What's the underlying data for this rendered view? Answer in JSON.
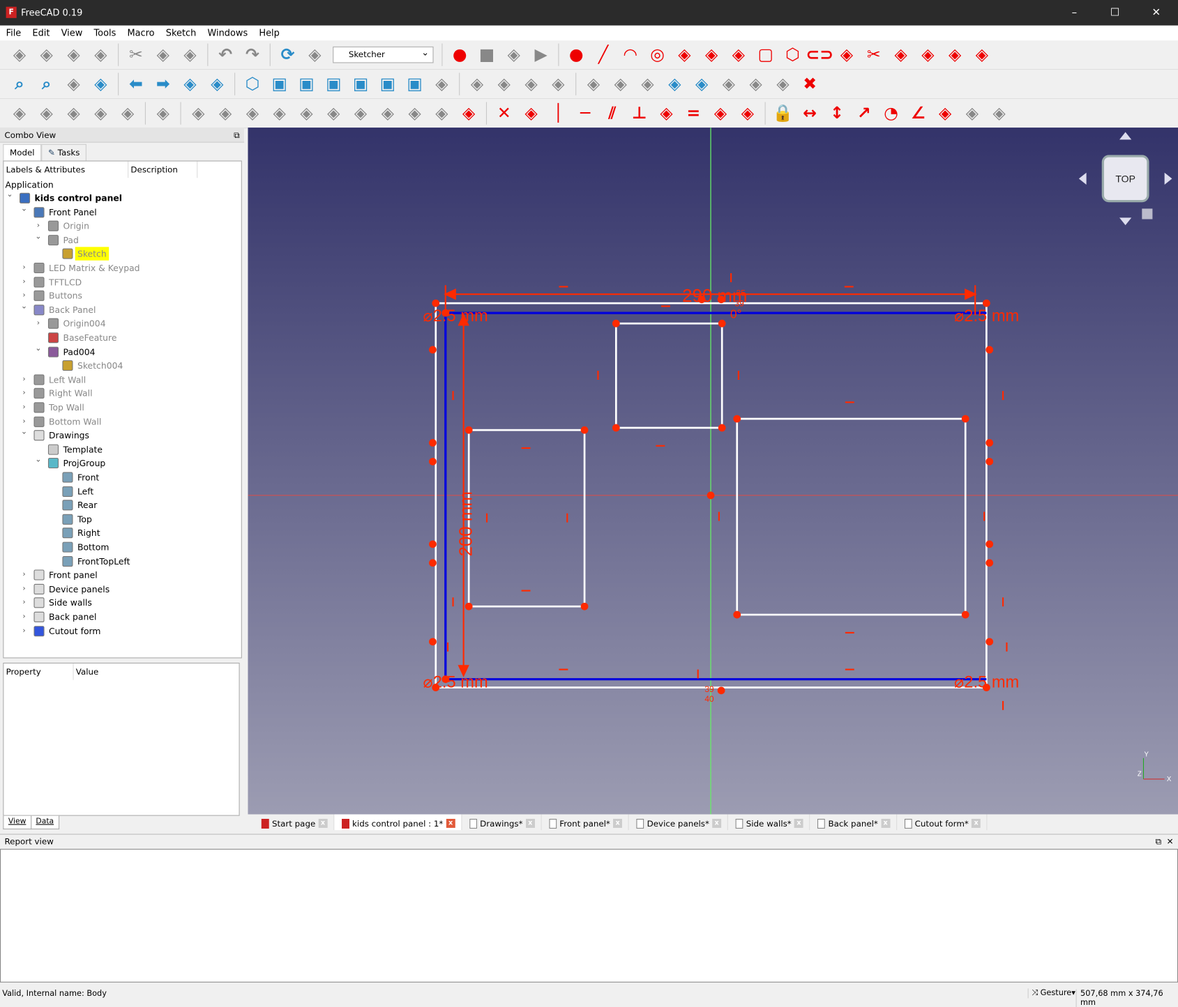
{
  "window": {
    "title": "FreeCAD 0.19",
    "minimize": "–",
    "maximize": "☐",
    "close": "✕"
  },
  "menu": [
    "File",
    "Edit",
    "View",
    "Tools",
    "Macro",
    "Sketch",
    "Windows",
    "Help"
  ],
  "toolbar1": [
    "new-file",
    "open-file",
    "save-file",
    "save-as",
    "sep",
    "cut",
    "copy",
    "paste",
    "sep",
    "undo",
    "redo",
    "sep",
    "refresh",
    "whats-this",
    "workbench",
    "sep",
    "record-macro",
    "stop-macro",
    "edit-macro",
    "run-macro",
    "sep",
    "sketch-point",
    "sketch-line",
    "sketch-arc",
    "sketch-circle",
    "sketch-conic",
    "sketch-bspline",
    "sketch-polyline",
    "sketch-rectangle",
    "sketch-polygon",
    "sketch-slot",
    "sketch-fillet",
    "sketch-trim",
    "sketch-extend",
    "sketch-external",
    "sketch-carbon-copy",
    "sketch-construction"
  ],
  "toolbar2": [
    "fit-all",
    "fit-selection",
    "draw-style",
    "bounding-box",
    "sep",
    "back",
    "forward",
    "sync-view",
    "std-views",
    "sep",
    "isometric",
    "front-view",
    "top-view",
    "right-view",
    "rear-view",
    "bottom-view",
    "left-view",
    "measure",
    "sep",
    "create-part",
    "create-group",
    "link",
    "link-actions",
    "sep",
    "new-sketch",
    "map-sketch",
    "leave-sketch",
    "view-sketch",
    "view-section",
    "merge-sketches",
    "mirror-sketch",
    "validate-sketch",
    "close-sketch"
  ],
  "toolbar3": [
    "show-hide-geometry",
    "select-elements",
    "select-constraints",
    "select-origin",
    "select-conflicting",
    "sep",
    "show-hide-grid",
    "sep",
    "dof",
    "select-redundant",
    "select-h-axis",
    "select-v-axis",
    "restore-internal",
    "symmetric",
    "clone",
    "copy",
    "move",
    "rectangular-array",
    "delete-constraints",
    "sep",
    "constrain-coincident",
    "constrain-point-on-object",
    "constrain-vertical",
    "constrain-horizontal",
    "constrain-parallel",
    "constrain-perpendicular",
    "constrain-tangent",
    "constrain-equal",
    "constrain-symmetric",
    "constrain-block",
    "sep",
    "constrain-lock",
    "constrain-h-distance",
    "constrain-v-distance",
    "constrain-distance",
    "constrain-radius",
    "constrain-angle",
    "constrain-snell",
    "toggle-driving",
    "toggle-active"
  ],
  "workbench": {
    "selected": "Sketcher"
  },
  "combo": {
    "title": "Combo View",
    "tabs": [
      "Model",
      "Tasks"
    ],
    "col_labels": "Labels & Attributes",
    "col_desc": "Description",
    "application": "Application"
  },
  "tree": [
    {
      "level": 0,
      "label": "kids control panel",
      "state": "open",
      "bold": true,
      "grey": false,
      "color": "#3a6fc0"
    },
    {
      "level": 1,
      "label": "Front Panel",
      "state": "open",
      "grey": false,
      "color": "#4a78b8"
    },
    {
      "level": 2,
      "label": "Origin",
      "state": "closed",
      "grey": true,
      "color": "#999"
    },
    {
      "level": 2,
      "label": "Pad",
      "state": "open",
      "grey": true,
      "color": "#999"
    },
    {
      "level": 3,
      "label": "Sketch",
      "state": "none",
      "grey": true,
      "highlight": true,
      "color": "#c8a030"
    },
    {
      "level": 1,
      "label": "LED Matrix & Keypad",
      "state": "closed",
      "grey": true,
      "color": "#999"
    },
    {
      "level": 1,
      "label": "TFTLCD",
      "state": "closed",
      "grey": true,
      "color": "#999"
    },
    {
      "level": 1,
      "label": "Buttons",
      "state": "closed",
      "grey": true,
      "color": "#999"
    },
    {
      "level": 1,
      "label": "Back Panel",
      "state": "open",
      "grey": true,
      "color": "#8888c8"
    },
    {
      "level": 2,
      "label": "Origin004",
      "state": "closed",
      "grey": true,
      "color": "#999"
    },
    {
      "level": 2,
      "label": "BaseFeature",
      "state": "none",
      "grey": true,
      "color": "#c44"
    },
    {
      "level": 2,
      "label": "Pad004",
      "state": "open",
      "grey": false,
      "color": "#8a5a9a"
    },
    {
      "level": 3,
      "label": "Sketch004",
      "state": "none",
      "grey": true,
      "color": "#c8a030"
    },
    {
      "level": 1,
      "label": "Left Wall",
      "state": "closed",
      "grey": true,
      "color": "#999"
    },
    {
      "level": 1,
      "label": "Right Wall",
      "state": "closed",
      "grey": true,
      "color": "#999"
    },
    {
      "level": 1,
      "label": "Top Wall",
      "state": "closed",
      "grey": true,
      "color": "#999"
    },
    {
      "level": 1,
      "label": "Bottom Wall",
      "state": "closed",
      "grey": true,
      "color": "#999"
    },
    {
      "level": 1,
      "label": "Drawings",
      "state": "open",
      "grey": false,
      "color": "#ddd"
    },
    {
      "level": 2,
      "label": "Template",
      "state": "none",
      "grey": false,
      "color": "#ccc"
    },
    {
      "level": 2,
      "label": "ProjGroup",
      "state": "open",
      "grey": false,
      "color": "#5ab8c8"
    },
    {
      "level": 3,
      "label": "Front",
      "state": "none",
      "grey": false,
      "color": "#7aa0b8"
    },
    {
      "level": 3,
      "label": "Left",
      "state": "none",
      "grey": false,
      "color": "#7aa0b8"
    },
    {
      "level": 3,
      "label": "Rear",
      "state": "none",
      "grey": false,
      "color": "#7aa0b8"
    },
    {
      "level": 3,
      "label": "Top",
      "state": "none",
      "grey": false,
      "color": "#7aa0b8"
    },
    {
      "level": 3,
      "label": "Right",
      "state": "none",
      "grey": false,
      "color": "#7aa0b8"
    },
    {
      "level": 3,
      "label": "Bottom",
      "state": "none",
      "grey": false,
      "color": "#7aa0b8"
    },
    {
      "level": 3,
      "label": "FrontTopLeft",
      "state": "none",
      "grey": false,
      "color": "#7aa0b8"
    },
    {
      "level": 1,
      "label": "Front panel",
      "state": "closed",
      "grey": false,
      "color": "#ddd"
    },
    {
      "level": 1,
      "label": "Device panels",
      "state": "closed",
      "grey": false,
      "color": "#ddd"
    },
    {
      "level": 1,
      "label": "Side walls",
      "state": "closed",
      "grey": false,
      "color": "#ddd"
    },
    {
      "level": 1,
      "label": "Back panel",
      "state": "closed",
      "grey": false,
      "color": "#ddd"
    },
    {
      "level": 1,
      "label": "Cutout form",
      "state": "closed",
      "grey": false,
      "color": "#3355dd"
    }
  ],
  "props": {
    "col_property": "Property",
    "col_value": "Value",
    "tabs": [
      "View",
      "Data"
    ]
  },
  "viewport": {
    "navcube_face": "TOP",
    "dim_width": "290 mm",
    "dim_height": "200 mm",
    "dia": "⌀2.5 mm",
    "angle": "0°",
    "c35": "35",
    "c39": "39",
    "c40": "40",
    "axis_x": "X",
    "axis_y": "Y",
    "axis_z": "Z"
  },
  "doc_tabs": [
    {
      "label": "Start page",
      "icon": "freecad",
      "active": false
    },
    {
      "label": "kids control panel : 1*",
      "icon": "freecad",
      "active": true
    },
    {
      "label": "Drawings*",
      "icon": "page",
      "active": false
    },
    {
      "label": "Front panel*",
      "icon": "page",
      "active": false
    },
    {
      "label": "Device panels*",
      "icon": "page",
      "active": false
    },
    {
      "label": "Side walls*",
      "icon": "page",
      "active": false
    },
    {
      "label": "Back panel*",
      "icon": "page",
      "active": false
    },
    {
      "label": "Cutout form*",
      "icon": "page",
      "active": false
    }
  ],
  "report": {
    "title": "Report view"
  },
  "status": {
    "message": "Valid, Internal name: Body",
    "nav_style": "Gesture",
    "dimensions": "507,68 mm x 374,76 mm"
  },
  "colors": {
    "constraint": "#ff2a00",
    "edge": "#ffffff",
    "blue_edge": "#0000dd",
    "h_axis": "#d05050",
    "v_axis": "#66ee66"
  }
}
